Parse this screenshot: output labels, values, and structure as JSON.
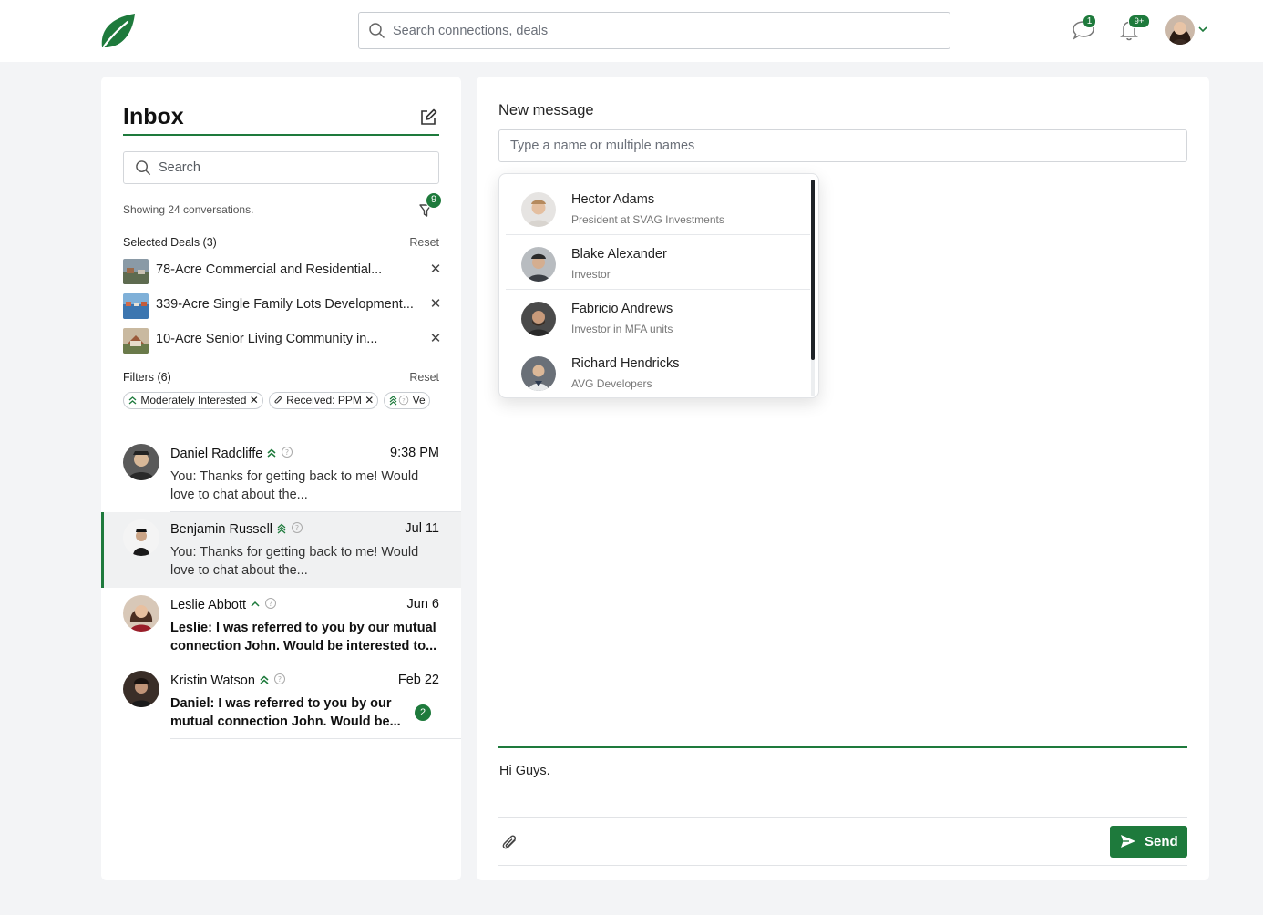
{
  "header": {
    "search_placeholder": "Search connections, deals",
    "messages_badge": "1",
    "notifications_badge": "9+"
  },
  "inbox": {
    "title": "Inbox",
    "search_placeholder": "Search",
    "showing_text": "Showing 24 conversations.",
    "filter_badge": "9",
    "selected_deals_label": "Selected Deals (3)",
    "reset_label": "Reset",
    "deals": [
      {
        "name": "78-Acre Commercial and Residential..."
      },
      {
        "name": "339-Acre Single Family Lots Development..."
      },
      {
        "name": "10-Acre Senior Living Community in..."
      }
    ],
    "filters_label": "Filters (6)",
    "filter_chips": [
      "Moderately Interested",
      "Received: PPM",
      "Ve"
    ],
    "conversations": [
      {
        "name": "Daniel Radcliffe",
        "time": "9:38 PM",
        "message": "You: Thanks for getting back to me! Would love to chat about the..."
      },
      {
        "name": "Benjamin Russell",
        "time": "Jul 11",
        "message": "You: Thanks for getting back to me! Would love to chat about the..."
      },
      {
        "name": "Leslie Abbott",
        "time": "Jun 6",
        "message": "Leslie: I was referred to you by our mutual connection John. Would be interested to..."
      },
      {
        "name": "Kristin Watson",
        "time": "Feb 22",
        "message": "Daniel: I was referred to you by our mutual connection John. Would be...",
        "unread": "2"
      }
    ]
  },
  "compose": {
    "title": "New message",
    "to_placeholder": "Type a name or multiple names",
    "suggestions": [
      {
        "name": "Hector Adams",
        "role": "President at SVAG Investments"
      },
      {
        "name": "Blake Alexander",
        "role": "Investor"
      },
      {
        "name": "Fabricio Andrews",
        "role": "Investor in MFA units"
      },
      {
        "name": "Richard Hendricks",
        "role": "AVG Developers"
      }
    ],
    "body": "Hi Guys.",
    "send_label": "Send"
  },
  "colors": {
    "accent": "#1e7a3c",
    "background": "#f3f4f6"
  }
}
